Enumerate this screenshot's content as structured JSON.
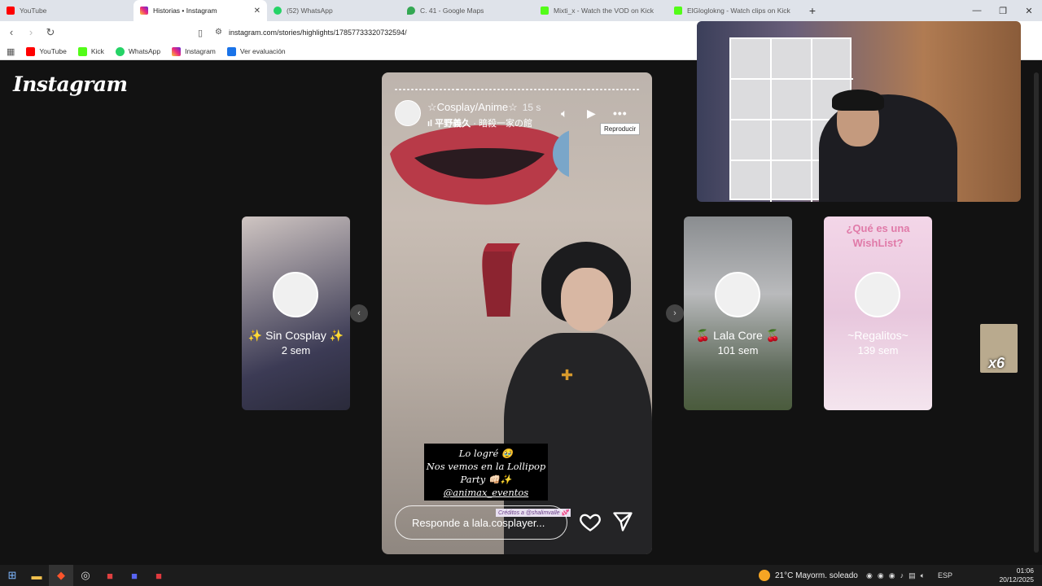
{
  "browser": {
    "tabs": [
      {
        "label": "YouTube",
        "color": "#ff0000"
      },
      {
        "label": "Historias • Instagram",
        "color": "#d6249f"
      },
      {
        "label": "(52) WhatsApp",
        "color": "#25d366"
      },
      {
        "label": "C. 41 - Google Maps",
        "color": "#34a853"
      },
      {
        "label": "Mixti_x - Watch the VOD on Kick",
        "color": "#53fc18"
      },
      {
        "label": "ElGloglokng - Watch clips on Kick",
        "color": "#53fc18"
      }
    ],
    "active_tab_index": 1,
    "url": "instagram.com/stories/highlights/17857733320732594/",
    "bookmarks": [
      {
        "label": "YouTube",
        "color": "#ff0000"
      },
      {
        "label": "Kick",
        "color": "#53fc18"
      },
      {
        "label": "WhatsApp",
        "color": "#25d366"
      },
      {
        "label": "Instagram",
        "color": "#d6249f"
      },
      {
        "label": "Ver evaluación",
        "color": "#1a73e8"
      }
    ]
  },
  "instagram": {
    "logo": "Instagram",
    "story": {
      "username": "☆Cosplay/Anime☆",
      "time": "15 s",
      "music": "平野義久",
      "music_sub": " · 暗殺一家の館",
      "tooltip": "Reproducir",
      "caption_line1": "Lo logré 🥹",
      "caption_line2": "Nos vemos en la Lollipop",
      "caption_line3": "Party 👊🏻✨",
      "caption_line4": "@animax_eventos",
      "credits": "Créditos a @shalimvalle 💕",
      "reply_placeholder": "Responde a lala.cosplayer..."
    },
    "thumbs": [
      {
        "title": "✨ Sin Cosplay ✨",
        "when": "2 sem"
      },
      {
        "title": "🍒 Lala Core 🍒",
        "when": "101 sem"
      },
      {
        "title": "~Regalitos~",
        "when": "139 sem",
        "heading": "¿Qué es una WishList?"
      }
    ],
    "more_count": "x6"
  },
  "taskbar": {
    "weather": "21°C  Mayorm. soleado",
    "lang": "ESP",
    "time": "01:06",
    "date": "20/12/2025"
  }
}
